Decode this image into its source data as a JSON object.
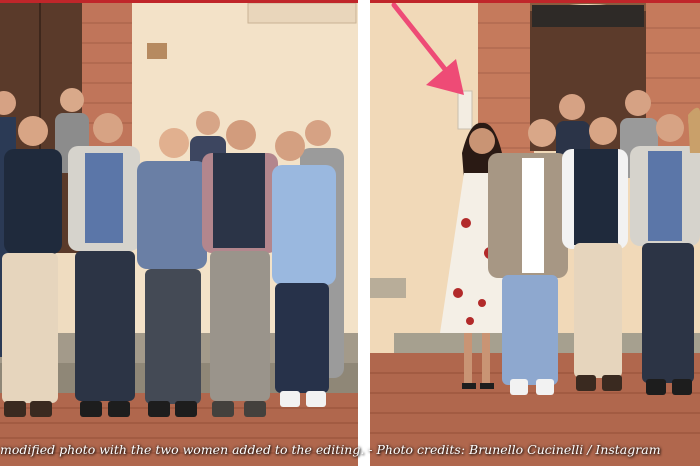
{
  "caption": "modified photo with the two women added to the editing. - Photo credits: Brunello Cucinelli / Instagram",
  "colors": {
    "accent_bar": "#c0262a",
    "arrow": "#ee4b76",
    "wall": "#f1d9b8",
    "brick_floor": "#b0674d"
  },
  "icons": {
    "arrow": "red-arrow-icon"
  }
}
